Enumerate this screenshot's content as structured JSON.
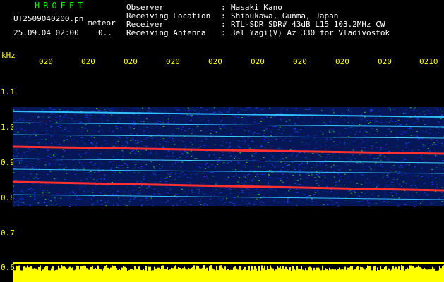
{
  "header": {
    "brand": "HROFFT",
    "filename": "UT2509040200.pn",
    "mode": "meteor",
    "datetime": "25.09.04 02:00",
    "count": "0..",
    "meta": [
      {
        "key": "Observer",
        "value": "Masaki Kano"
      },
      {
        "key": "Receiving Location",
        "value": "Shibukawa, Gunma, Japan"
      },
      {
        "key": "Receiver",
        "value": "RTL-SDR SDR# 43dB L15 103.2MHz CW"
      },
      {
        "key": "Receiving Antenna",
        "value": "3el Yagi(V) Az 330 for Vladivostok"
      }
    ]
  },
  "axes": {
    "unit": "kHz",
    "x_ticks": [
      "020",
      "020",
      "020",
      "020",
      "020",
      "020",
      "020",
      "020",
      "020",
      "0210"
    ],
    "y_ticks": [
      "1.1",
      "1.0",
      "0.9",
      "0.8",
      "0.7",
      "0.6"
    ]
  },
  "colors": {
    "text": "#ffffff",
    "brand": "#00ff00",
    "tick": "#ffff00",
    "signal_strong": "#ff3030",
    "noise_mid": "#20c040",
    "noise_low": "#2040ff",
    "baseline": "#ffff00"
  }
}
